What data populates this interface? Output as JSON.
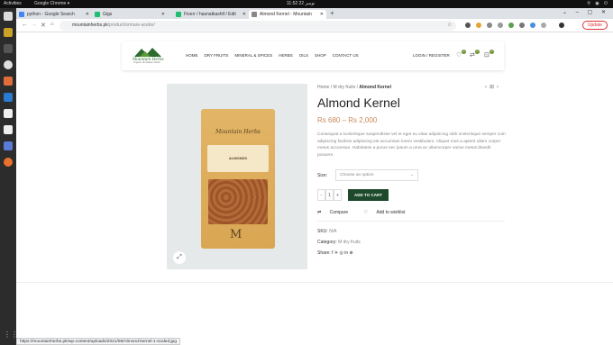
{
  "os": {
    "activities": "Activities",
    "app": "Google Chrome ▾",
    "clock": "11:52 22 نومبر"
  },
  "tabs": [
    {
      "label": "python - Google Search",
      "color": "#4285f4"
    },
    {
      "label": "Gigs",
      "color": "#1dbf73"
    },
    {
      "label": "Fiverr / hasnatkashif / Edit",
      "color": "#1dbf73"
    },
    {
      "label": "Almond Kernel - Mountain",
      "color": "#888888"
    }
  ],
  "address": {
    "domain": "mountainherbs.pk",
    "path": "/product/ormare-acebo/",
    "update": "Update"
  },
  "site": {
    "menu": [
      "HOME",
      "DRY FRUITS",
      "MINERAL & SPICES",
      "HERBS",
      "OILS",
      "SHOP",
      "CONTACT US"
    ],
    "login": "LOGIN / REGISTER",
    "wishlist_count": "0",
    "compare_count": "0",
    "cart_count": "0",
    "logo_text": "Mountain Herbs",
    "logo_sub": "Organic Himalayan Herbs"
  },
  "product": {
    "crumb_home": "Home",
    "crumb_sep1": "/",
    "crumb_cat": "M dry fruits",
    "crumb_sep2": "/",
    "crumb_current": "Almond Kernel",
    "title": "Almond Kernel",
    "price": "Rs 680 – Rs 2,000",
    "description": "Consequat a scelerisque suspendisse vel et eget eu vitae adipiscing nibh scelerisque semper cum adipiscing facilisis adipiscing est accumsan lorem vestibulum. Aliquet mus a aptent ullam corper metus accumsan. Habitasse a purus nec ipsum a urna ac ullamcorper varius metus blandit posuere.",
    "size_label": "Size:",
    "size_placeholder": "Choose an option",
    "qty_minus": "-",
    "qty_value": "1",
    "qty_plus": "+",
    "add_to_cart": "ADD TO CART",
    "compare": "Compare",
    "wishlist": "Add to wishlist",
    "sku_label": "SKU:",
    "sku_value": "N/A",
    "category_label": "Category:",
    "category_value": "M dry fruits",
    "share_label": "Share:",
    "share_icons": "f  ✈  ◎  in  ⊕",
    "bag_brand": "Mountain Herbs",
    "bag_name": "ALMONDS",
    "bag_mark": "M"
  },
  "status_url": "https://mountainherbs.pk/wp-content/uploads/2021/08/Almond-kernel-1-scaled.jpg"
}
